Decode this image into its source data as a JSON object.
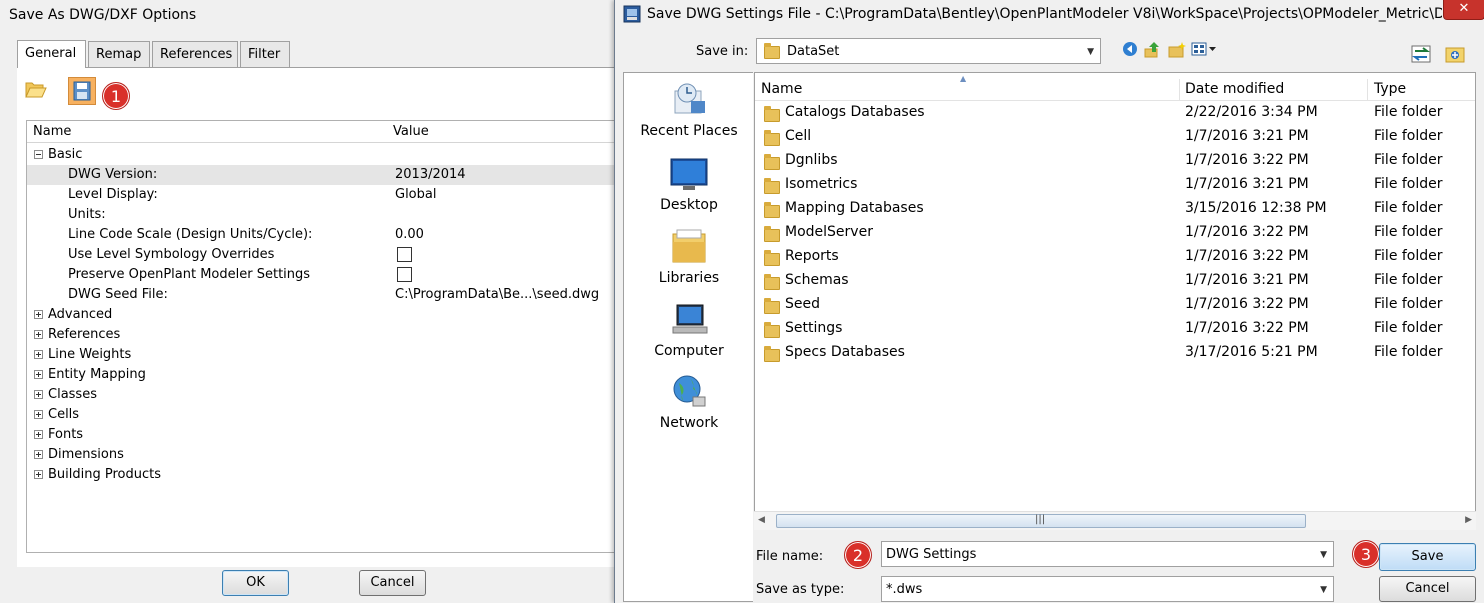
{
  "left_dialog": {
    "title": "Save As DWG/DXF Options",
    "tabs": [
      {
        "label": "General",
        "active": true
      },
      {
        "label": "Remap",
        "active": false
      },
      {
        "label": "References",
        "active": false
      },
      {
        "label": "Filter",
        "active": false
      }
    ],
    "badge_1": "1",
    "grid": {
      "name_header": "Name",
      "value_header": "Value",
      "basic_group": "Basic",
      "basic_rows": [
        {
          "name": "DWG Version:",
          "value": "2013/2014"
        },
        {
          "name": "Level Display:",
          "value": "Global"
        },
        {
          "name": "Units:",
          "value": ""
        },
        {
          "name": "Line Code Scale (Design Units/Cycle):",
          "value": "0.00"
        },
        {
          "name": "Use Level Symbology Overrides",
          "value": ""
        },
        {
          "name": "Preserve OpenPlant Modeler Settings",
          "value": ""
        },
        {
          "name": "DWG Seed File:",
          "value": "C:\\ProgramData\\Be...\\seed.dwg"
        }
      ],
      "collapsed_groups": [
        "Advanced",
        "References",
        "Line Weights",
        "Entity Mapping",
        "Classes",
        "Cells",
        "Fonts",
        "Dimensions",
        "Building Products"
      ]
    },
    "ok_label": "OK",
    "cancel_label": "Cancel"
  },
  "right_dialog": {
    "title": "Save DWG Settings File - C:\\ProgramData\\Bentley\\OpenPlantModeler V8i\\WorkSpace\\Projects\\OPModeler_Metric\\Da...",
    "close_glyph": "✕",
    "save_in_label": "Save in:",
    "save_in_value": "DataSet",
    "places": [
      "Recent Places",
      "Desktop",
      "Libraries",
      "Computer",
      "Network"
    ],
    "columns": {
      "name": "Name",
      "date": "Date modified",
      "type": "Type"
    },
    "files": [
      {
        "name": "Catalogs Databases",
        "date": "2/22/2016 3:34 PM",
        "type": "File folder"
      },
      {
        "name": "Cell",
        "date": "1/7/2016 3:21 PM",
        "type": "File folder"
      },
      {
        "name": "Dgnlibs",
        "date": "1/7/2016 3:22 PM",
        "type": "File folder"
      },
      {
        "name": "Isometrics",
        "date": "1/7/2016 3:21 PM",
        "type": "File folder"
      },
      {
        "name": "Mapping Databases",
        "date": "3/15/2016 12:38 PM",
        "type": "File folder"
      },
      {
        "name": "ModelServer",
        "date": "1/7/2016 3:22 PM",
        "type": "File folder"
      },
      {
        "name": "Reports",
        "date": "1/7/2016 3:22 PM",
        "type": "File folder"
      },
      {
        "name": "Schemas",
        "date": "1/7/2016 3:21 PM",
        "type": "File folder"
      },
      {
        "name": "Seed",
        "date": "1/7/2016 3:22 PM",
        "type": "File folder"
      },
      {
        "name": "Settings",
        "date": "1/7/2016 3:22 PM",
        "type": "File folder"
      },
      {
        "name": "Specs Databases",
        "date": "3/17/2016 5:21 PM",
        "type": "File folder"
      }
    ],
    "file_name_label": "File name:",
    "file_name_value": "DWG Settings",
    "save_as_type_label": "Save as type:",
    "save_as_type_value": "*.dws",
    "badge_2": "2",
    "badge_3": "3",
    "save_label": "Save",
    "cancel_label": "Cancel"
  }
}
